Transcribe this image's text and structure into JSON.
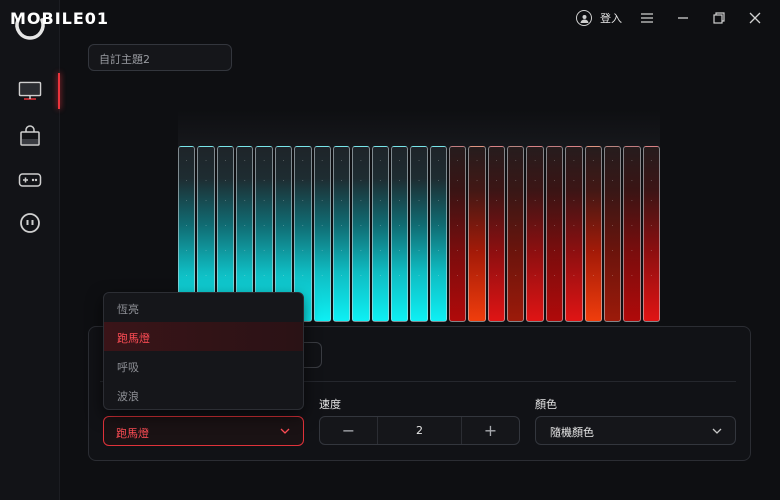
{
  "app": {
    "logo_text": "MOBILE01",
    "login_label": "登入"
  },
  "sidebar": {
    "items": [
      {
        "name": "monitor",
        "active": true
      },
      {
        "name": "shop",
        "active": false
      },
      {
        "name": "gamepad",
        "active": false
      },
      {
        "name": "mascot",
        "active": false
      }
    ]
  },
  "theme": {
    "name": "自訂主題2"
  },
  "keyboard": {
    "columns": [
      "cyan",
      "cyan",
      "cyan",
      "cyan",
      "cyan",
      "cyan",
      "cyan",
      "cyan",
      "cyan",
      "cyan",
      "cyan",
      "cyan",
      "cyan",
      "cyan",
      "red1",
      "red2",
      "red3",
      "red4",
      "red3",
      "red1",
      "red3",
      "red2",
      "red4",
      "red1",
      "red3"
    ]
  },
  "effect": {
    "mode_label": "",
    "mode_value": "跑馬燈",
    "mode_options": [
      "恆亮",
      "跑馬燈",
      "呼吸",
      "波浪"
    ],
    "selected_index": 1,
    "speed_label": "速度",
    "speed_value": "2",
    "decrement": "−",
    "increment": "+",
    "color_label": "顏色",
    "color_value": "隨機顏色"
  },
  "colors": {
    "accent": "#e8343c",
    "cyan": "#0ef0f4",
    "red": "#e01414",
    "background": "#0e0f12"
  }
}
